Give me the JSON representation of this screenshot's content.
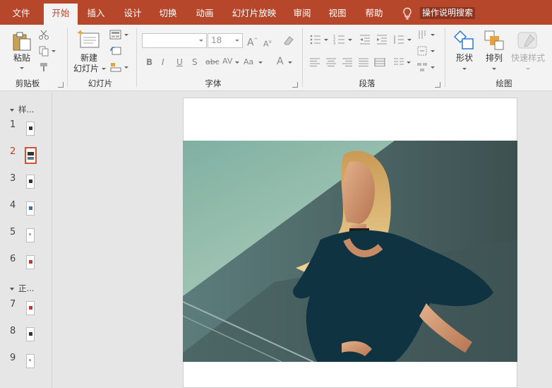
{
  "tabs": [
    {
      "label": "文件",
      "active": false
    },
    {
      "label": "开始",
      "active": true
    },
    {
      "label": "插入",
      "active": false
    },
    {
      "label": "设计",
      "active": false
    },
    {
      "label": "切换",
      "active": false
    },
    {
      "label": "动画",
      "active": false
    },
    {
      "label": "幻灯片放映",
      "active": false
    },
    {
      "label": "审阅",
      "active": false
    },
    {
      "label": "视图",
      "active": false
    },
    {
      "label": "帮助",
      "active": false
    }
  ],
  "tell_me": {
    "icon": "lightbulb-icon",
    "label": "操作说明搜索"
  },
  "ribbon": {
    "clipboard": {
      "label": "剪贴板",
      "paste": "粘贴"
    },
    "slides": {
      "label": "幻灯片",
      "new_slide_line1": "新建",
      "new_slide_line2": "幻灯片"
    },
    "font": {
      "label": "字体",
      "font_name": "",
      "font_size": "18"
    },
    "paragraph": {
      "label": "段落"
    },
    "drawing": {
      "label": "绘图",
      "shapes": "形状",
      "arrange": "排列",
      "quick_styles": "快速样式"
    }
  },
  "thumbnails": {
    "sections": [
      {
        "label": "样..."
      },
      {
        "label": "正..."
      }
    ],
    "slides": [
      {
        "number": "1",
        "active": false
      },
      {
        "number": "2",
        "active": true
      },
      {
        "number": "3",
        "active": false
      },
      {
        "number": "4",
        "active": false
      },
      {
        "number": "5",
        "active": false
      },
      {
        "number": "6",
        "active": false
      },
      {
        "number": "7",
        "active": false
      },
      {
        "number": "8",
        "active": false
      },
      {
        "number": "9",
        "active": false
      }
    ]
  },
  "colors": {
    "accent": "#b7472a",
    "active_thumb": "#d35230"
  }
}
